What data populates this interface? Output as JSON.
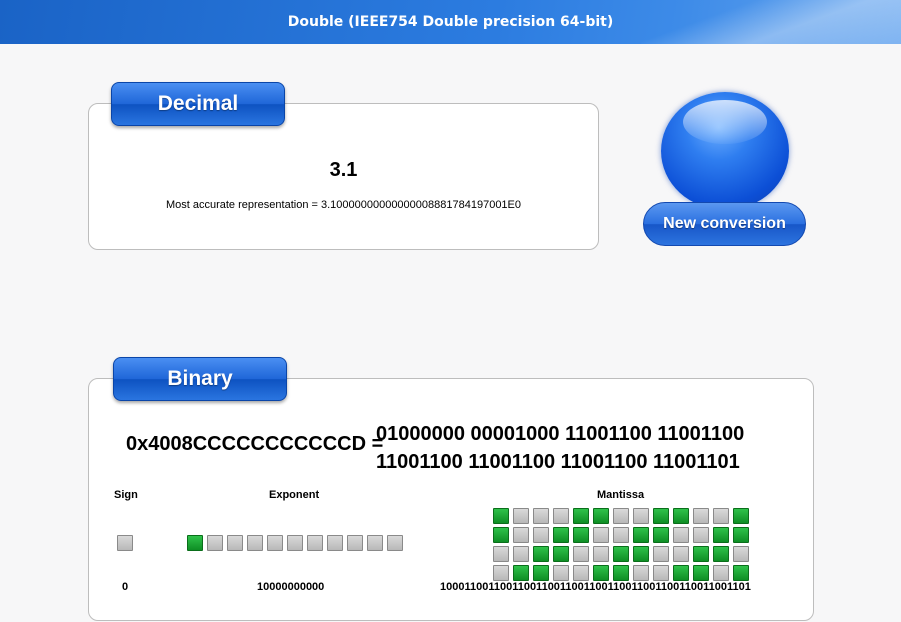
{
  "title": "Double (IEEE754 Double precision 64-bit)",
  "decimal": {
    "tag": "Decimal",
    "value": "3.1",
    "accurate": "Most accurate representation = 3.10000000000000008881784197001E0"
  },
  "new_conversion_label": "New conversion",
  "binary": {
    "tag": "Binary",
    "hex": "0x4008CCCCCCCCCCCD =",
    "bits_line1": "01000000 00001000 11001100 11001100",
    "bits_line2": "11001100 11001100 11001100 11001101",
    "sign_header": "Sign",
    "exponent_header": "Exponent",
    "mantissa_header": "Mantissa",
    "sign_bits": "0",
    "exponent_bits": "10000000000",
    "mantissa_bits": "1000110011001100110011001100110011001100110011001101"
  },
  "colors": {
    "bit_on": "#16a832",
    "bit_off": "#c6c6c6",
    "accent": "#1f66d8"
  }
}
